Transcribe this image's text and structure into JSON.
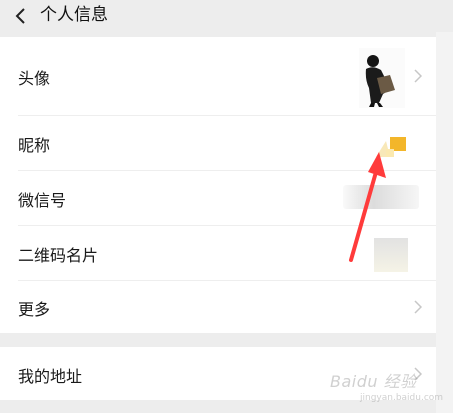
{
  "header": {
    "back_icon": "chevron-left-icon",
    "title": "个人信息"
  },
  "rows": {
    "avatar": "头像",
    "nickname": "昵称",
    "wechat_id": "微信号",
    "qr_card": "二维码名片",
    "more": "更多",
    "address": "我的地址"
  },
  "icons": {
    "row_chevron": "chevron-right-icon"
  },
  "annotation": {
    "arrow_color": "#ff3b3b"
  },
  "watermark": {
    "text": "Baidu 经验",
    "sub": "jingyan.baidu.com"
  },
  "colors": {
    "background": "#ededed",
    "card": "#ffffff",
    "text": "#191919",
    "chevron": "#c7c7c7"
  }
}
